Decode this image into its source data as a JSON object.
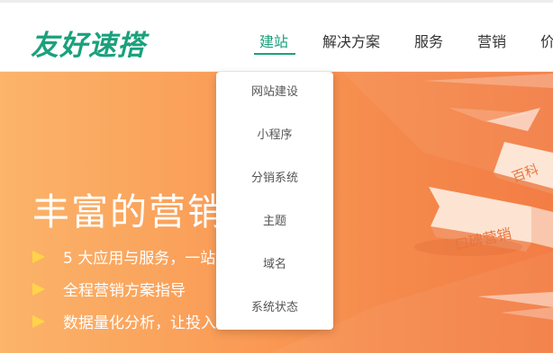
{
  "logo": {
    "text": "友好速搭"
  },
  "nav": {
    "items": [
      {
        "label": "建站",
        "active": true
      },
      {
        "label": "解决方案",
        "active": false
      },
      {
        "label": "服务",
        "active": false
      },
      {
        "label": "营销",
        "active": false
      },
      {
        "label": "价",
        "active": false
      }
    ]
  },
  "dropdown": {
    "items": [
      "网站建设",
      "小程序",
      "分销系统",
      "主题",
      "域名",
      "系统状态"
    ]
  },
  "hero": {
    "title": "丰富的营销",
    "bullets": [
      "5 大应用与服务，一站",
      "全程营销方案指导",
      "数据量化分析，让投入"
    ],
    "arrow_labels": [
      "百科",
      "口碑营销"
    ]
  },
  "colors": {
    "brand": "#1aa17c",
    "hero_start": "#fbb46a",
    "hero_end": "#f37d45",
    "bullet": "#ffd447"
  }
}
